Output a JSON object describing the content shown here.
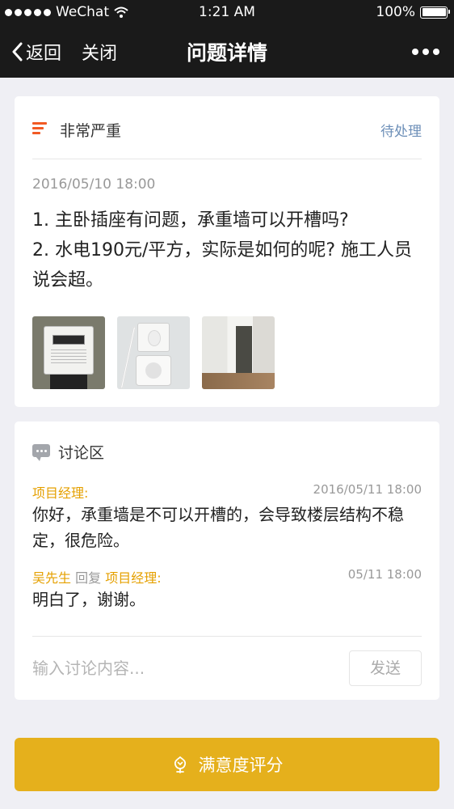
{
  "status_bar": {
    "carrier": "WeChat",
    "time": "1:21 AM",
    "battery": "100%"
  },
  "nav": {
    "back_label": "返回",
    "close_label": "关闭",
    "title": "问题详情"
  },
  "issue": {
    "severity": "非常严重",
    "status": "待处理",
    "time": "2016/05/10 18:00",
    "lines": [
      "1. 主卧插座有问题，承重墙可以开槽吗?",
      "2. 水电190元/平方，实际是如何的呢? 施工人员说会超。"
    ],
    "photos": [
      "electric-meter-photo",
      "wall-outlet-photo",
      "room-corridor-photo"
    ]
  },
  "discussion": {
    "title": "讨论区",
    "messages": [
      {
        "author": "项目经理:",
        "time": "2016/05/11 18:00",
        "text": "你好，承重墙是不可以开槽的，会导致楼层结构不稳定，很危险。"
      },
      {
        "author": "吴先生",
        "reply_word": "回复",
        "reply_to": "项目经理:",
        "time": "05/11 18:00",
        "text": "明白了，谢谢。"
      }
    ],
    "input_placeholder": "输入讨论内容...",
    "send_label": "发送"
  },
  "rate_button_label": "满意度评分",
  "colors": {
    "accent": "#e5b01c",
    "severity": "#f15a24",
    "status": "#6d8fb8",
    "author": "#e5a000"
  }
}
